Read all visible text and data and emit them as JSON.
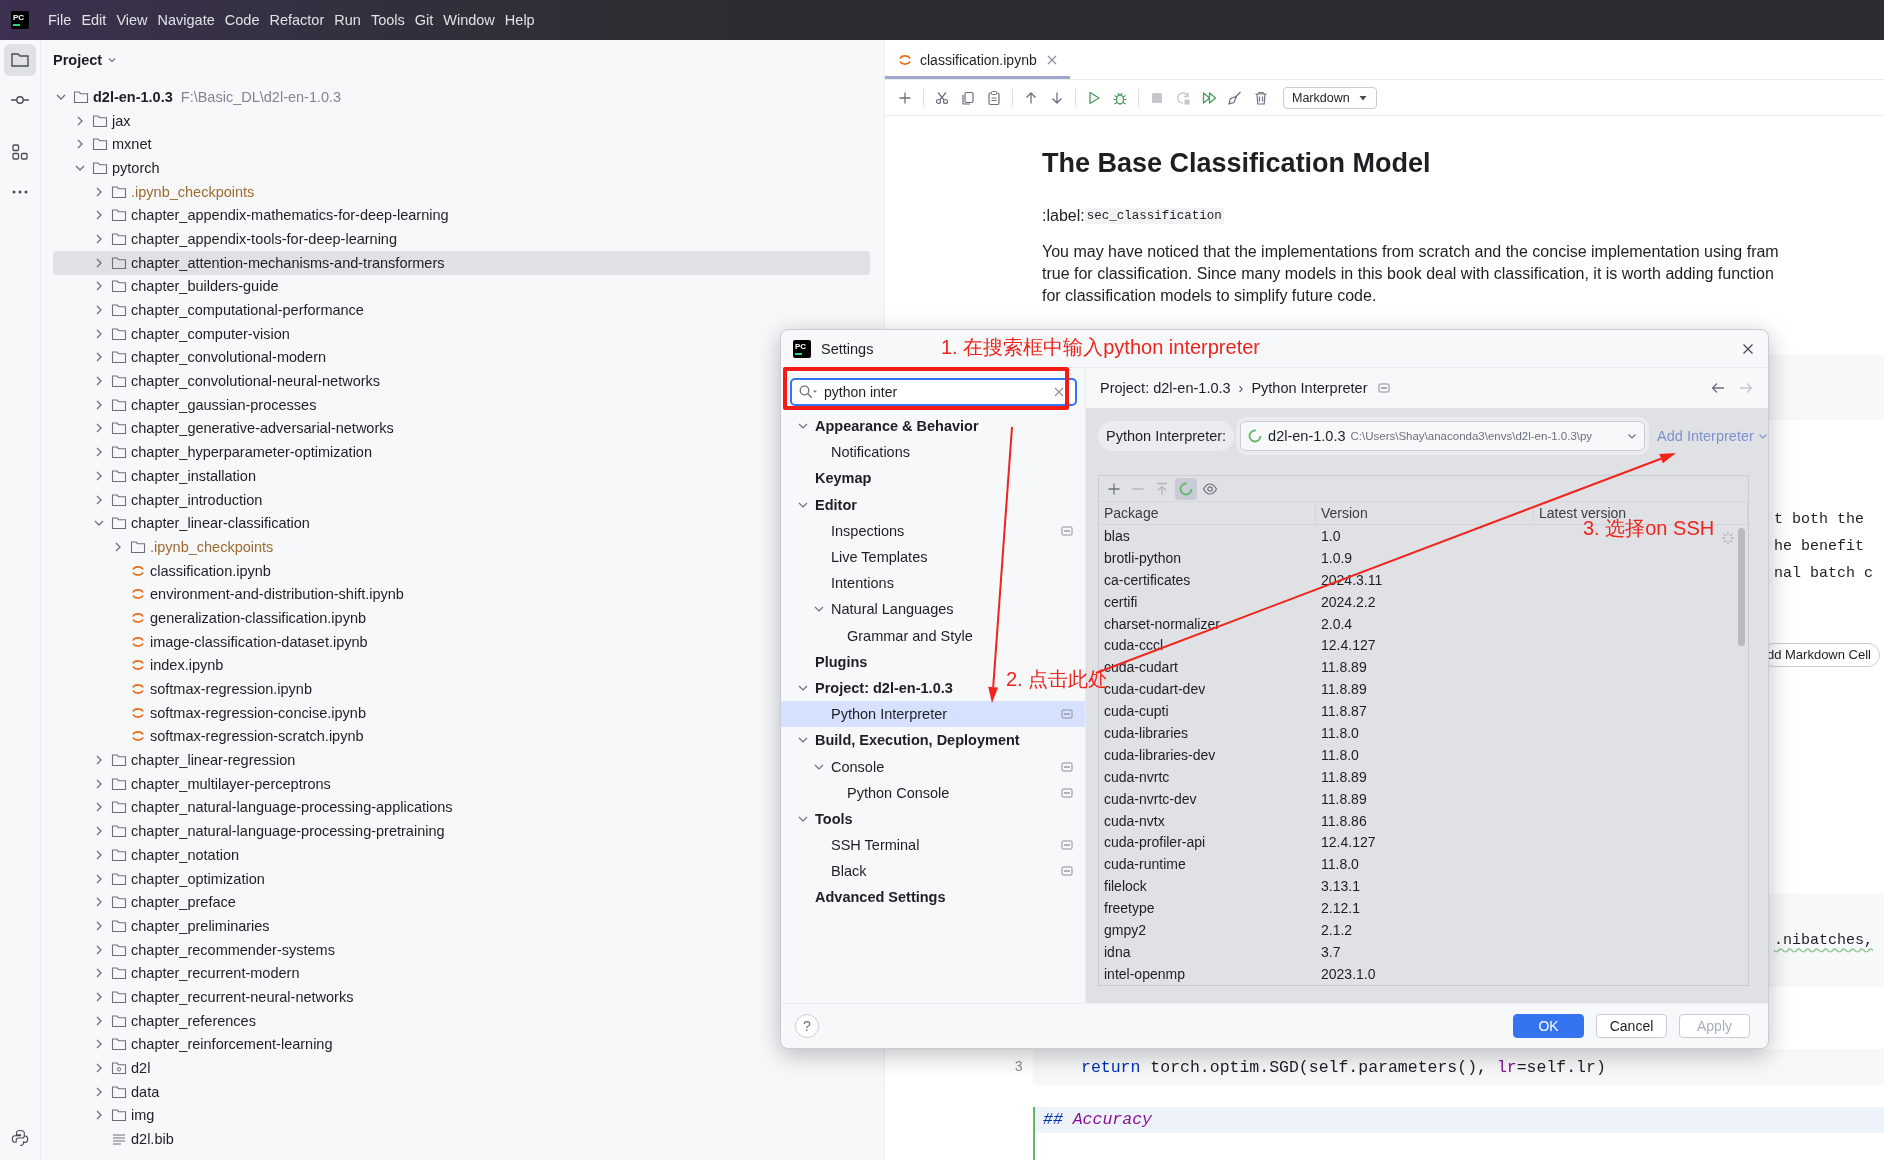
{
  "menu_bar": {
    "logo_text": "PC",
    "items": [
      "File",
      "Edit",
      "View",
      "Navigate",
      "Code",
      "Refactor",
      "Run",
      "Tools",
      "Git",
      "Window",
      "Help"
    ]
  },
  "tool_strip": [
    {
      "kind": "project",
      "selected": true
    },
    {
      "kind": "commit",
      "selected": false
    },
    {
      "kind": "structure",
      "selected": false
    },
    {
      "kind": "more",
      "selected": false
    },
    {
      "kind": "python_console",
      "selected": false
    }
  ],
  "project_panel": {
    "title": "Project",
    "tree": [
      {
        "label": "d2l-en-1.0.3",
        "path": "F:\\Basic_DL\\d2l-en-1.0.3",
        "kind": "folder",
        "expanded": true,
        "selected": false,
        "children": [
          {
            "label": "jax",
            "kind": "folder",
            "expanded": false,
            "selected": false
          },
          {
            "label": "mxnet",
            "kind": "folder",
            "expanded": false,
            "selected": false
          },
          {
            "label": "pytorch",
            "kind": "folder",
            "expanded": true,
            "selected": false,
            "children": [
              {
                "label": ".ipynb_checkpoints",
                "kind": "excluded_folder",
                "expanded": false,
                "selected": false
              },
              {
                "label": "chapter_appendix-mathematics-for-deep-learning",
                "kind": "folder",
                "expanded": false,
                "selected": false
              },
              {
                "label": "chapter_appendix-tools-for-deep-learning",
                "kind": "folder",
                "expanded": false,
                "selected": false
              },
              {
                "label": "chapter_attention-mechanisms-and-transformers",
                "kind": "folder",
                "expanded": false,
                "selected": true
              },
              {
                "label": "chapter_builders-guide",
                "kind": "folder",
                "expanded": false,
                "selected": false
              },
              {
                "label": "chapter_computational-performance",
                "kind": "folder",
                "expanded": false,
                "selected": false
              },
              {
                "label": "chapter_computer-vision",
                "kind": "folder",
                "expanded": false,
                "selected": false
              },
              {
                "label": "chapter_convolutional-modern",
                "kind": "folder",
                "expanded": false,
                "selected": false
              },
              {
                "label": "chapter_convolutional-neural-networks",
                "kind": "folder",
                "expanded": false,
                "selected": false
              },
              {
                "label": "chapter_gaussian-processes",
                "kind": "folder",
                "expanded": false,
                "selected": false
              },
              {
                "label": "chapter_generative-adversarial-networks",
                "kind": "folder",
                "expanded": false,
                "selected": false
              },
              {
                "label": "chapter_hyperparameter-optimization",
                "kind": "folder",
                "expanded": false,
                "selected": false
              },
              {
                "label": "chapter_installation",
                "kind": "folder",
                "expanded": false,
                "selected": false
              },
              {
                "label": "chapter_introduction",
                "kind": "folder",
                "expanded": false,
                "selected": false
              },
              {
                "label": "chapter_linear-classification",
                "kind": "folder",
                "expanded": true,
                "selected": false,
                "children": [
                  {
                    "label": ".ipynb_checkpoints",
                    "kind": "excluded_folder",
                    "expanded": false,
                    "selected": false
                  },
                  {
                    "label": "classification.ipynb",
                    "kind": "notebook",
                    "selected": false
                  },
                  {
                    "label": "environment-and-distribution-shift.ipynb",
                    "kind": "notebook",
                    "selected": false
                  },
                  {
                    "label": "generalization-classification.ipynb",
                    "kind": "notebook",
                    "selected": false
                  },
                  {
                    "label": "image-classification-dataset.ipynb",
                    "kind": "notebook",
                    "selected": false
                  },
                  {
                    "label": "index.ipynb",
                    "kind": "notebook",
                    "selected": false
                  },
                  {
                    "label": "softmax-regression.ipynb",
                    "kind": "notebook",
                    "selected": false
                  },
                  {
                    "label": "softmax-regression-concise.ipynb",
                    "kind": "notebook",
                    "selected": false
                  },
                  {
                    "label": "softmax-regression-scratch.ipynb",
                    "kind": "notebook",
                    "selected": false
                  }
                ]
              },
              {
                "label": "chapter_linear-regression",
                "kind": "folder",
                "expanded": false,
                "selected": false
              },
              {
                "label": "chapter_multilayer-perceptrons",
                "kind": "folder",
                "expanded": false,
                "selected": false
              },
              {
                "label": "chapter_natural-language-processing-applications",
                "kind": "folder",
                "expanded": false,
                "selected": false
              },
              {
                "label": "chapter_natural-language-processing-pretraining",
                "kind": "folder",
                "expanded": false,
                "selected": false
              },
              {
                "label": "chapter_notation",
                "kind": "folder",
                "expanded": false,
                "selected": false
              },
              {
                "label": "chapter_optimization",
                "kind": "folder",
                "expanded": false,
                "selected": false
              },
              {
                "label": "chapter_preface",
                "kind": "folder",
                "expanded": false,
                "selected": false
              },
              {
                "label": "chapter_preliminaries",
                "kind": "folder",
                "expanded": false,
                "selected": false
              },
              {
                "label": "chapter_recommender-systems",
                "kind": "folder",
                "expanded": false,
                "selected": false
              },
              {
                "label": "chapter_recurrent-modern",
                "kind": "folder",
                "expanded": false,
                "selected": false
              },
              {
                "label": "chapter_recurrent-neural-networks",
                "kind": "folder",
                "expanded": false,
                "selected": false
              },
              {
                "label": "chapter_references",
                "kind": "folder",
                "expanded": false,
                "selected": false
              },
              {
                "label": "chapter_reinforcement-learning",
                "kind": "folder",
                "expanded": false,
                "selected": false
              },
              {
                "label": "d2l",
                "kind": "package_folder",
                "expanded": false,
                "selected": false
              },
              {
                "label": "data",
                "kind": "folder",
                "expanded": false,
                "selected": false
              },
              {
                "label": "img",
                "kind": "folder",
                "expanded": false,
                "selected": false
              },
              {
                "label": "d2l.bib",
                "kind": "text_file",
                "selected": false
              }
            ]
          }
        ]
      }
    ]
  },
  "editor": {
    "tabs": [
      {
        "label": "classification.ipynb",
        "selected": true
      }
    ],
    "cell_type": "Markdown",
    "heading": "The Base Classification Model",
    "label_prefix": ":label:",
    "label_code": "sec_classification",
    "paragraph_lines": [
      "You may have noticed that the implementations from scratch and the concise implementation using fram",
      "true for classification. Since many models in this book deal with classification, it is worth adding function",
      "for classification models to simplify future code."
    ],
    "text_fragments": [
      "t both the",
      "he benefit",
      "nal batch c"
    ],
    "add_cell_button": "dd Markdown Cell",
    "code_fragment": ".nibatches,",
    "code_line": {
      "number": "3",
      "tokens": [
        {
          "kind": "keyword",
          "text": "return"
        },
        {
          "kind": "plain",
          "text": " torch.optim.SGD(self.parameters(), "
        },
        {
          "kind": "param",
          "text": "lr"
        },
        {
          "kind": "plain",
          "text": "=self.lr)"
        }
      ]
    },
    "markdown_line": {
      "marker": "##",
      "text": "Accuracy"
    }
  },
  "settings_dialog": {
    "logo_text": "PC",
    "title": "Settings",
    "search": {
      "value": "python inter"
    },
    "nav": [
      {
        "label": "Appearance & Behavior",
        "expanded": true,
        "selected": false,
        "scoped": false,
        "children": [
          {
            "label": "Notifications",
            "selected": false,
            "scoped": false
          }
        ]
      },
      {
        "label": "Keymap",
        "selected": false,
        "scoped": false
      },
      {
        "label": "Editor",
        "expanded": true,
        "selected": false,
        "scoped": false,
        "children": [
          {
            "label": "Inspections",
            "selected": false,
            "scoped": true
          },
          {
            "label": "Live Templates",
            "selected": false,
            "scoped": false
          },
          {
            "label": "Intentions",
            "selected": false,
            "scoped": false
          },
          {
            "label": "Natural Languages",
            "expanded": true,
            "selected": false,
            "scoped": false,
            "children": [
              {
                "label": "Grammar and Style",
                "selected": false,
                "scoped": false
              }
            ]
          }
        ]
      },
      {
        "label": "Plugins",
        "selected": false,
        "scoped": false
      },
      {
        "label": "Project: d2l-en-1.0.3",
        "expanded": true,
        "selected": false,
        "scoped": false,
        "children": [
          {
            "label": "Python Interpreter",
            "selected": true,
            "scoped": true
          }
        ]
      },
      {
        "label": "Build, Execution, Deployment",
        "expanded": true,
        "selected": false,
        "scoped": false,
        "children": [
          {
            "label": "Console",
            "expanded": true,
            "selected": false,
            "scoped": true,
            "children": [
              {
                "label": "Python Console",
                "selected": false,
                "scoped": true
              }
            ]
          }
        ]
      },
      {
        "label": "Tools",
        "expanded": true,
        "selected": false,
        "scoped": false,
        "children": [
          {
            "label": "SSH Terminal",
            "selected": false,
            "scoped": true
          },
          {
            "label": "Black",
            "selected": false,
            "scoped": true
          }
        ]
      },
      {
        "label": "Advanced Settings",
        "selected": false,
        "scoped": false
      }
    ],
    "breadcrumb": [
      "Project: d2l-en-1.0.3",
      "Python Interpreter"
    ],
    "breadcrumb_separator": "›",
    "nav_arrows": [
      {
        "kind": "back",
        "disabled": false
      },
      {
        "kind": "forward",
        "disabled": true
      }
    ],
    "interpreter": {
      "label": "Python Interpreter:",
      "name": "d2l-en-1.0.3",
      "path": "C:\\Users\\Shay\\anaconda3\\envs\\d2l-en-1.0.3\\py"
    },
    "add_interpreter": "Add Interpreter",
    "package_tools": [
      {
        "kind": "add",
        "disabled": false,
        "on": false
      },
      {
        "kind": "remove",
        "disabled": true,
        "on": false
      },
      {
        "kind": "upgrade",
        "disabled": true,
        "on": false
      },
      {
        "kind": "refresh",
        "disabled": false,
        "on": true
      },
      {
        "kind": "show",
        "disabled": false,
        "on": false
      }
    ],
    "columns": [
      "Package",
      "Version",
      "Latest version"
    ],
    "packages": [
      {
        "name": "blas",
        "version": "1.0"
      },
      {
        "name": "brotli-python",
        "version": "1.0.9"
      },
      {
        "name": "ca-certificates",
        "version": "2024.3.11"
      },
      {
        "name": "certifi",
        "version": "2024.2.2"
      },
      {
        "name": "charset-normalizer",
        "version": "2.0.4"
      },
      {
        "name": "cuda-cccl",
        "version": "12.4.127"
      },
      {
        "name": "cuda-cudart",
        "version": "11.8.89"
      },
      {
        "name": "cuda-cudart-dev",
        "version": "11.8.89"
      },
      {
        "name": "cuda-cupti",
        "version": "11.8.87"
      },
      {
        "name": "cuda-libraries",
        "version": "11.8.0"
      },
      {
        "name": "cuda-libraries-dev",
        "version": "11.8.0"
      },
      {
        "name": "cuda-nvrtc",
        "version": "11.8.89"
      },
      {
        "name": "cuda-nvrtc-dev",
        "version": "11.8.89"
      },
      {
        "name": "cuda-nvtx",
        "version": "11.8.86"
      },
      {
        "name": "cuda-profiler-api",
        "version": "12.4.127"
      },
      {
        "name": "cuda-runtime",
        "version": "11.8.0"
      },
      {
        "name": "filelock",
        "version": "3.13.1"
      },
      {
        "name": "freetype",
        "version": "2.12.1"
      },
      {
        "name": "gmpy2",
        "version": "2.1.2"
      },
      {
        "name": "idna",
        "version": "3.7"
      },
      {
        "name": "intel-openmp",
        "version": "2023.1.0"
      }
    ],
    "help": "?",
    "buttons": [
      {
        "label": "OK",
        "kind": "ok",
        "disabled": false
      },
      {
        "label": "Cancel",
        "kind": "cancel",
        "disabled": false
      },
      {
        "label": "Apply",
        "kind": "apply",
        "disabled": true
      }
    ]
  },
  "annotations": [
    {
      "kind": "box",
      "text": "1. 在搜索框中输入python interpreter"
    },
    {
      "kind": "arrow",
      "text": "2. 点击此处"
    },
    {
      "kind": "arrow",
      "text": "3. 选择on SSH"
    }
  ]
}
